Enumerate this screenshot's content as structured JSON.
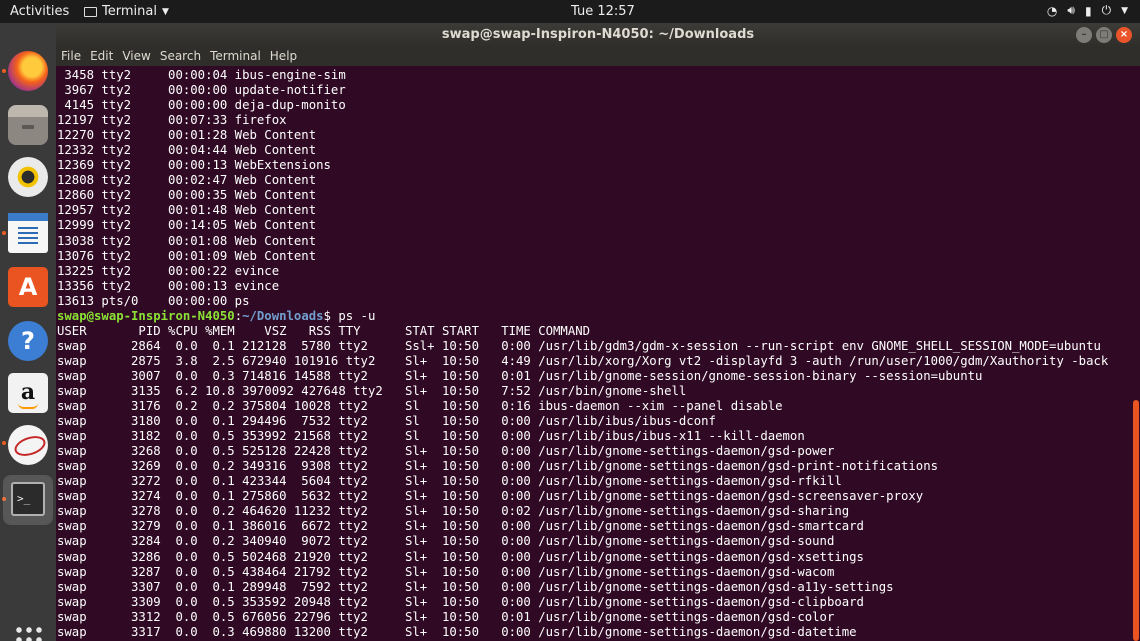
{
  "topbar": {
    "activities": "Activities",
    "app_menu": "Terminal",
    "clock": "Tue 12:57",
    "tray_icons": [
      "wifi-icon",
      "volume-icon",
      "battery-icon",
      "power-icon"
    ]
  },
  "dock": {
    "items": [
      "firefox",
      "files",
      "rhythmbox",
      "libreoffice-writer",
      "ubuntu-software",
      "help",
      "amazon",
      "evince",
      "terminal",
      "show-applications"
    ]
  },
  "window": {
    "title": "swap@swap-Inspiron-N4050: ~/Downloads",
    "menu": [
      "File",
      "Edit",
      "View",
      "Search",
      "Terminal",
      "Help"
    ]
  },
  "terminal": {
    "prev_output": [
      " 3458 tty2     00:00:04 ibus-engine-sim",
      " 3967 tty2     00:00:00 update-notifier",
      " 4145 tty2     00:00:00 deja-dup-monito",
      "12197 tty2     00:07:33 firefox",
      "12270 tty2     00:01:28 Web Content",
      "12332 tty2     00:04:44 Web Content",
      "12369 tty2     00:00:13 WebExtensions",
      "12808 tty2     00:02:47 Web Content",
      "12860 tty2     00:00:35 Web Content",
      "12957 tty2     00:01:48 Web Content",
      "12999 tty2     00:14:05 Web Content",
      "13038 tty2     00:01:08 Web Content",
      "13076 tty2     00:01:09 Web Content",
      "13225 tty2     00:00:22 evince",
      "13356 tty2     00:00:13 evince",
      "13613 pts/0    00:00:00 ps"
    ],
    "prompt_user": "swap@swap-Inspiron-N4050",
    "prompt_sep": ":",
    "prompt_path": "~/Downloads",
    "prompt_end": "$ ",
    "command": "ps -u",
    "ps_header": "USER       PID %CPU %MEM    VSZ   RSS TTY      STAT START   TIME COMMAND",
    "ps_rows": [
      "swap      2864  0.0  0.1 212128  5780 tty2     Ssl+ 10:50   0:00 /usr/lib/gdm3/gdm-x-session --run-script env GNOME_SHELL_SESSION_MODE=ubuntu",
      "swap      2875  3.8  2.5 672940 101916 tty2    Sl+  10:50   4:49 /usr/lib/xorg/Xorg vt2 -displayfd 3 -auth /run/user/1000/gdm/Xauthority -back",
      "swap      3007  0.0  0.3 714816 14588 tty2     Sl+  10:50   0:01 /usr/lib/gnome-session/gnome-session-binary --session=ubuntu",
      "swap      3135  6.2 10.8 3970092 427648 tty2   Sl+  10:50   7:52 /usr/bin/gnome-shell",
      "swap      3176  0.2  0.2 375804 10028 tty2     Sl   10:50   0:16 ibus-daemon --xim --panel disable",
      "swap      3180  0.0  0.1 294496  7532 tty2     Sl   10:50   0:00 /usr/lib/ibus/ibus-dconf",
      "swap      3182  0.0  0.5 353992 21568 tty2     Sl   10:50   0:00 /usr/lib/ibus/ibus-x11 --kill-daemon",
      "swap      3268  0.0  0.5 525128 22428 tty2     Sl+  10:50   0:00 /usr/lib/gnome-settings-daemon/gsd-power",
      "swap      3269  0.0  0.2 349316  9308 tty2     Sl+  10:50   0:00 /usr/lib/gnome-settings-daemon/gsd-print-notifications",
      "swap      3272  0.0  0.1 423344  5604 tty2     Sl+  10:50   0:00 /usr/lib/gnome-settings-daemon/gsd-rfkill",
      "swap      3274  0.0  0.1 275860  5632 tty2     Sl+  10:50   0:00 /usr/lib/gnome-settings-daemon/gsd-screensaver-proxy",
      "swap      3278  0.0  0.2 464620 11232 tty2     Sl+  10:50   0:02 /usr/lib/gnome-settings-daemon/gsd-sharing",
      "swap      3279  0.0  0.1 386016  6672 tty2     Sl+  10:50   0:00 /usr/lib/gnome-settings-daemon/gsd-smartcard",
      "swap      3284  0.0  0.2 340940  9072 tty2     Sl+  10:50   0:00 /usr/lib/gnome-settings-daemon/gsd-sound",
      "swap      3286  0.0  0.5 502468 21920 tty2     Sl+  10:50   0:00 /usr/lib/gnome-settings-daemon/gsd-xsettings",
      "swap      3287  0.0  0.5 438464 21792 tty2     Sl+  10:50   0:00 /usr/lib/gnome-settings-daemon/gsd-wacom",
      "swap      3307  0.0  0.1 289948  7592 tty2     Sl+  10:50   0:00 /usr/lib/gnome-settings-daemon/gsd-a11y-settings",
      "swap      3309  0.0  0.5 353592 20948 tty2     Sl+  10:50   0:00 /usr/lib/gnome-settings-daemon/gsd-clipboard",
      "swap      3312  0.0  0.5 676056 22796 tty2     Sl+  10:50   0:01 /usr/lib/gnome-settings-daemon/gsd-color",
      "swap      3317  0.0  0.3 469880 13200 tty2     Sl+  10:50   0:00 /usr/lib/gnome-settings-daemon/gsd-datetime"
    ]
  },
  "colors": {
    "terminal_bg": "#300a24",
    "prompt_user": "#8ae234",
    "prompt_path": "#729fcf",
    "accent": "#e95420"
  }
}
